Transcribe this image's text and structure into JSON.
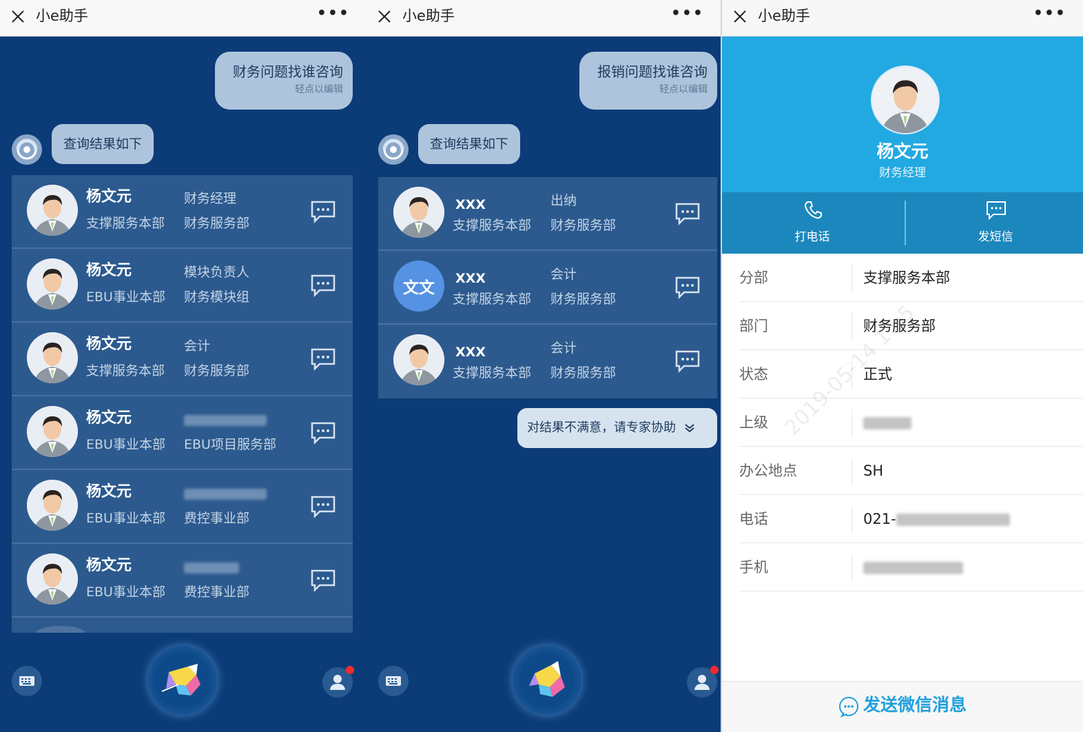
{
  "panels": [
    {
      "title": "小e助手",
      "query": {
        "text": "财务问题找谁咨询",
        "hint": "轻点以编辑"
      },
      "bot_reply": "查询结果如下",
      "results": [
        {
          "name": "杨文元",
          "role": "财务经理",
          "division": "支撑服务本部",
          "department": "财务服务部"
        },
        {
          "name": "杨文元",
          "role": "模块负责人",
          "division": "EBU事业本部",
          "department": "财务模块组"
        },
        {
          "name": "杨文元",
          "role": "会计",
          "division": "支撑服务本部",
          "department": "财务服务部"
        },
        {
          "name": "杨文元",
          "role": "",
          "division": "EBU事业本部",
          "department": "EBU项目服务部"
        },
        {
          "name": "杨文元",
          "role": "",
          "division": "EBU事业本部",
          "department": "费控事业部"
        },
        {
          "name": "杨文元",
          "role": "",
          "division": "EBU事业本部",
          "department": "费控事业部"
        }
      ]
    },
    {
      "title": "小e助手",
      "query": {
        "text": "报销问题找谁咨询",
        "hint": "轻点以编辑"
      },
      "bot_reply": "查询结果如下",
      "results": [
        {
          "name": "XXX",
          "role": "出纳",
          "division": "支撑服务本部",
          "department": "财务服务部",
          "avatar_text": ""
        },
        {
          "name": "XXX",
          "role": "会计",
          "division": "支撑服务本部",
          "department": "财务服务部",
          "avatar_text": "文文"
        },
        {
          "name": "XXX",
          "role": "会计",
          "division": "支撑服务本部",
          "department": "财务服务部",
          "avatar_text": ""
        }
      ],
      "expert_help": "对结果不满意，请专家协助"
    },
    {
      "title": "小e助手",
      "profile": {
        "name": "杨文元",
        "title": "财务经理"
      },
      "actions": {
        "call": "打电话",
        "sms": "发短信"
      },
      "info": [
        {
          "label": "分部",
          "value": "支撑服务本部"
        },
        {
          "label": "部门",
          "value": "财务服务部"
        },
        {
          "label": "状态",
          "value": "正式"
        },
        {
          "label": "上级",
          "value": ""
        },
        {
          "label": "办公地点",
          "value": "SH"
        },
        {
          "label": "电话",
          "value": "021-"
        },
        {
          "label": "手机",
          "value": ""
        }
      ],
      "watermark": "2019-05-14 17:5",
      "wechat_button": "发送微信消息"
    }
  ],
  "colors": {
    "chat_bg": "#0b3c78",
    "card_bg": "#2c5a8e",
    "bubble": "#aec4dd",
    "profile_header": "#22a9e2",
    "action_bar": "#1c87bc",
    "wechat_accent": "#22a0dd",
    "notification_dot": "#f02b2b"
  },
  "icons": [
    "close-icon",
    "more-icon",
    "bot-icon",
    "chat-bubble-icon",
    "keyboard-icon",
    "voice-assistant-icon",
    "contacts-icon",
    "phone-icon",
    "sms-icon",
    "wechat-icon",
    "chevron-down-icon"
  ]
}
